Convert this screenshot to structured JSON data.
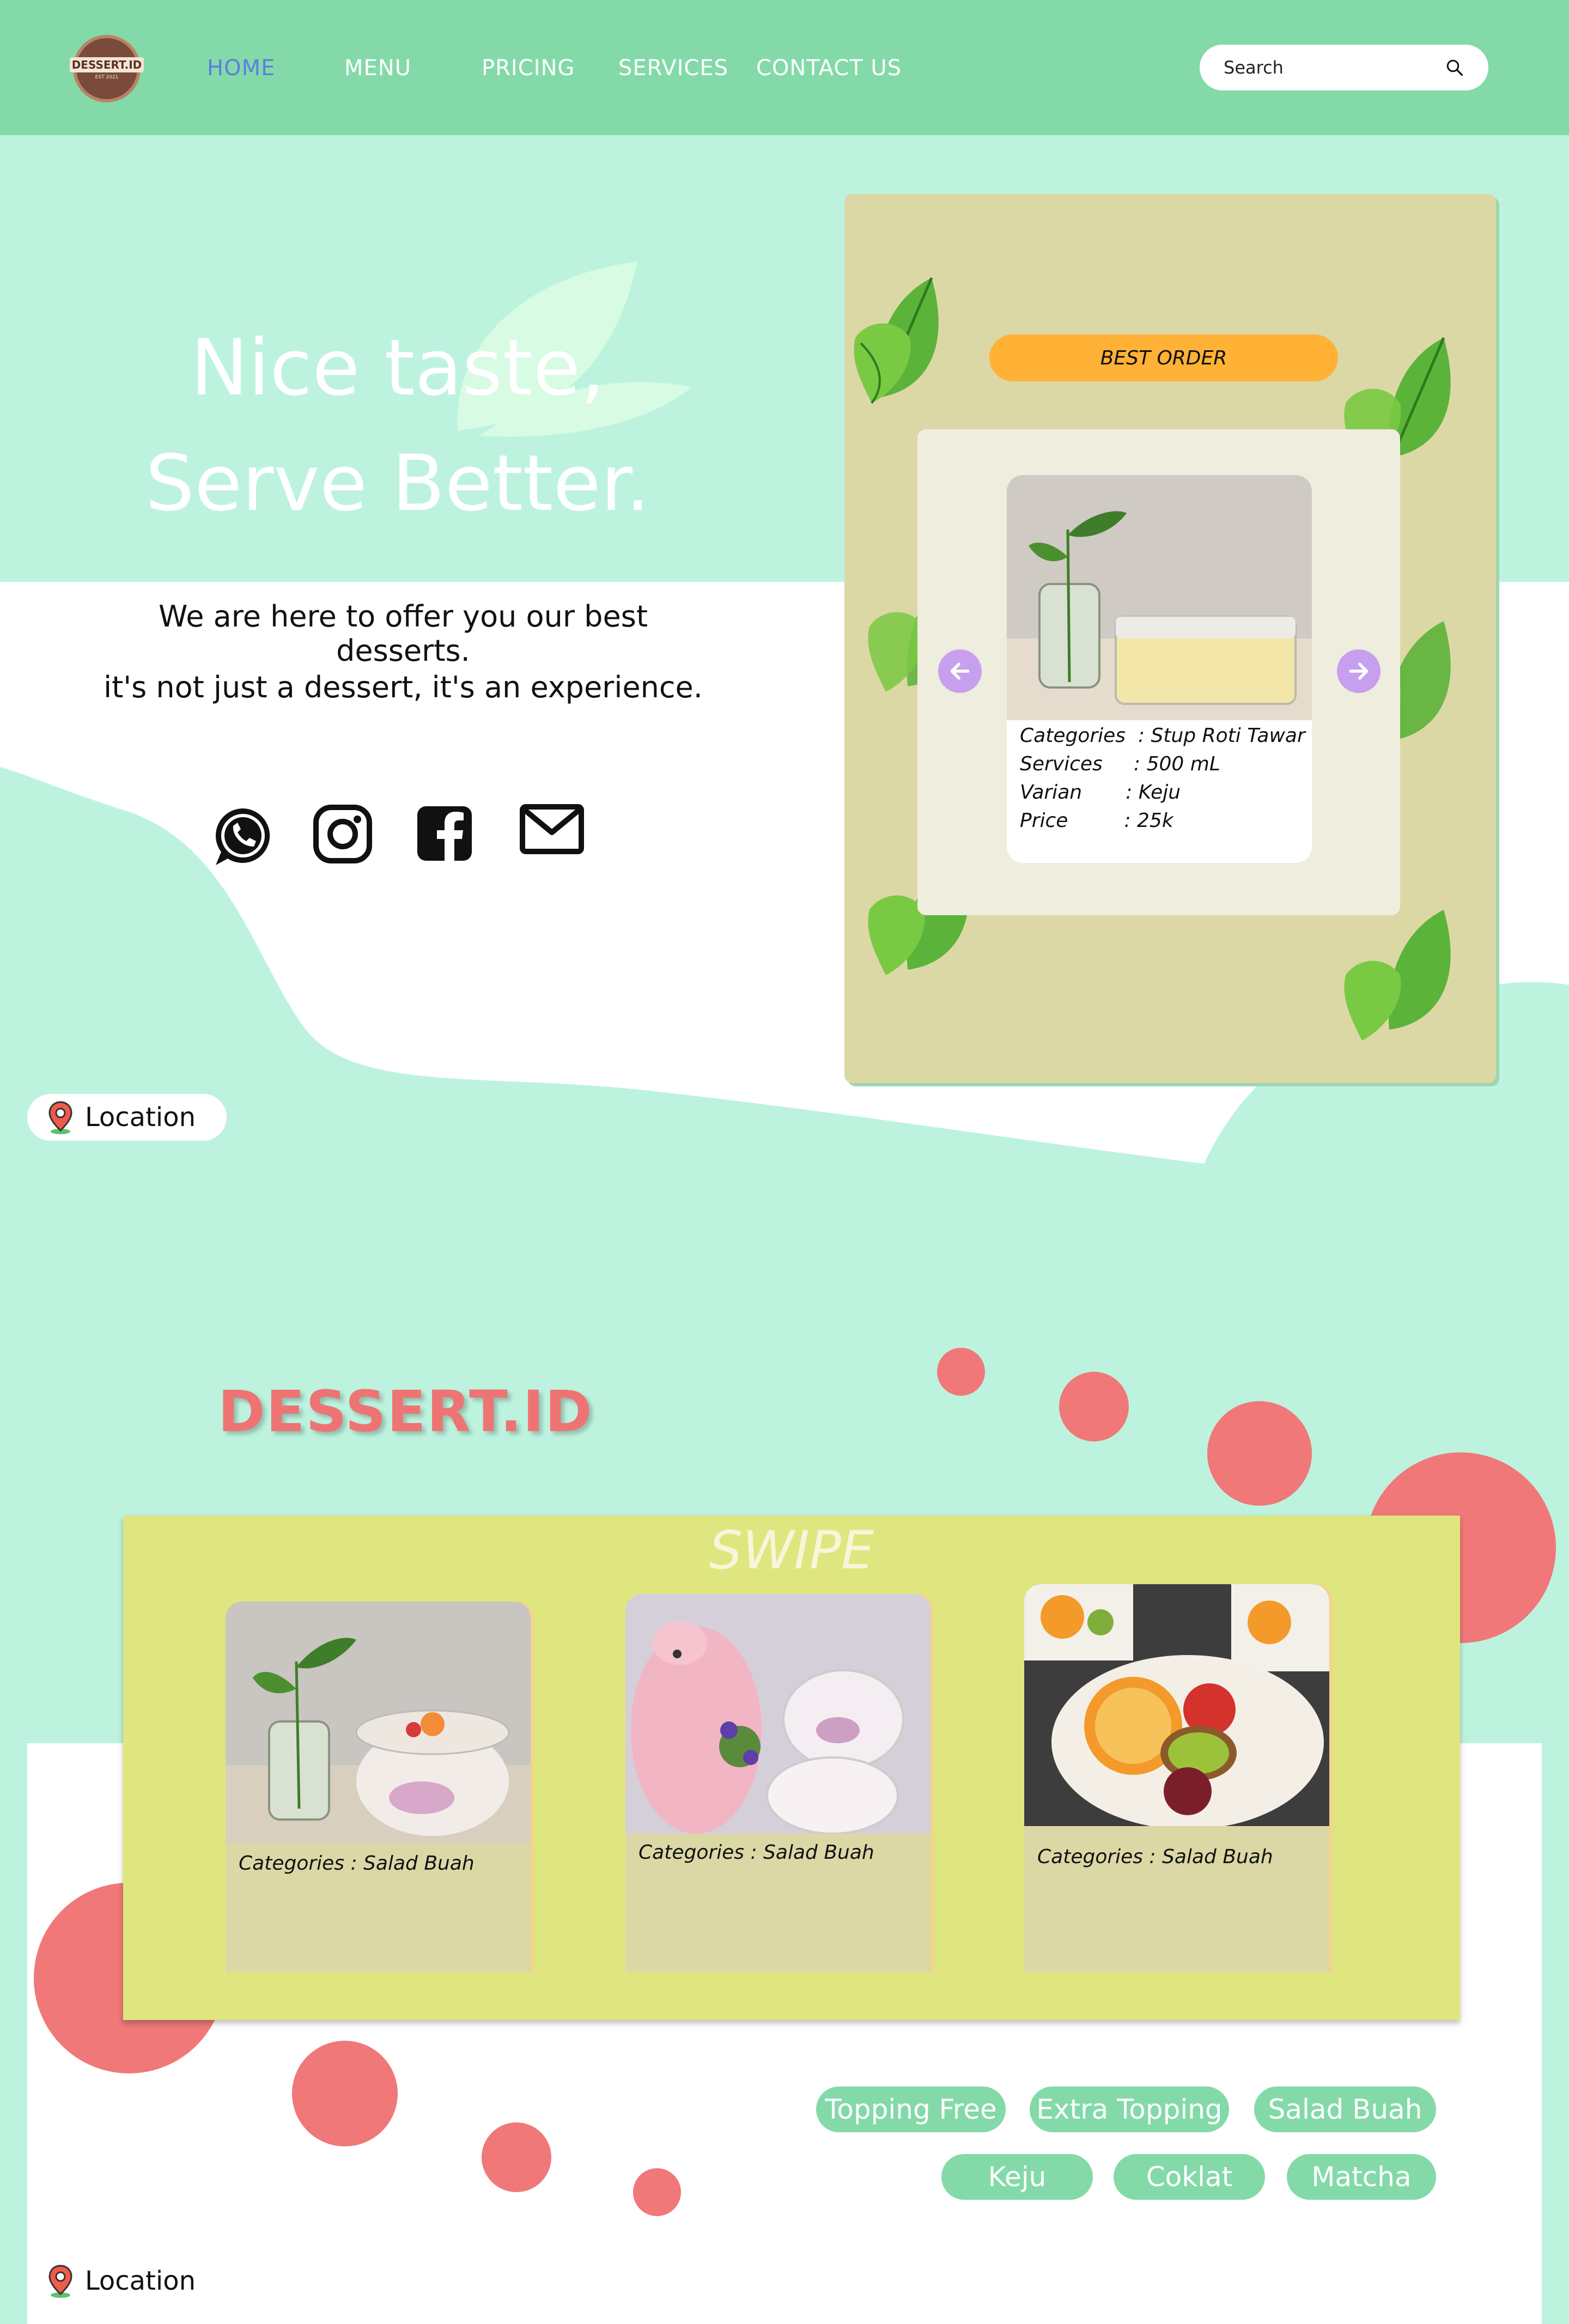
{
  "brand": {
    "logo_text": "DESSERT.ID",
    "logo_sub": "EST 2021",
    "title": "DESSERT.ID"
  },
  "nav": {
    "items": [
      {
        "label": "HOME",
        "active": true
      },
      {
        "label": "MENU",
        "active": false
      },
      {
        "label": "PRICING",
        "active": false
      },
      {
        "label": "SERVICES",
        "active": false
      },
      {
        "label": "CONTACT US",
        "active": false
      }
    ],
    "search_label": "Search",
    "search_icon": "search-icon"
  },
  "hero": {
    "title_line1": "Nice taste,",
    "title_line2": "Serve Better.",
    "sub_line1": "We are here to offer you our best desserts.",
    "sub_line2": "it's not just a dessert, it's an experience.",
    "socials": [
      "whatsapp-icon",
      "instagram-icon",
      "facebook-icon",
      "mail-icon"
    ]
  },
  "best_order": {
    "badge": "BEST ORDER",
    "details": [
      {
        "key": "Categories",
        "value": ": Stup Roti Tawar"
      },
      {
        "key": "Services",
        "value": ": 500 mL"
      },
      {
        "key": "Varian",
        "value": ": Keju"
      },
      {
        "key": "Price",
        "value": ": 25k"
      }
    ]
  },
  "location_label": "Location",
  "swipe": {
    "title": "SWIPE",
    "cards": [
      {
        "category": "Categories   : Salad Buah"
      },
      {
        "category": "Categories   : Salad Buah"
      },
      {
        "category": "Categories   : Salad Buah"
      }
    ]
  },
  "tags": {
    "row1": [
      "Topping Free",
      "Extra Topping",
      "Salad Buah"
    ],
    "row2": [
      "Keju",
      "Coklat",
      "Matcha"
    ]
  },
  "colors": {
    "nav": "#83daa8",
    "mint": "#bdf3de",
    "accent": "#ffb236",
    "coral": "#f07878",
    "swipe": "#dfe67f",
    "card": "#dcd8a6"
  }
}
